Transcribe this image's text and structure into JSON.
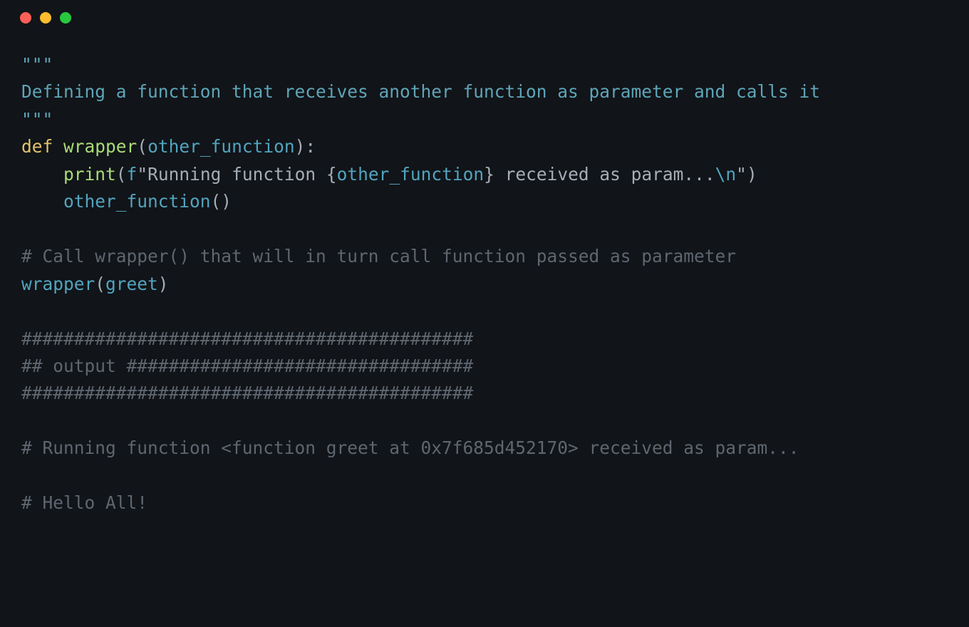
{
  "code": {
    "docstring_open": "\"\"\"",
    "docstring_text": "Defining a function that receives another function as parameter and calls it",
    "docstring_close": "\"\"\"",
    "def_kw": "def",
    "def_name": "wrapper",
    "def_paren_open": "(",
    "def_param": "other_function",
    "def_paren_close": ")",
    "def_colon": ":",
    "indent": "    ",
    "print_fn": "print",
    "print_open": "(",
    "f_prefix": "f",
    "f_open": "\"",
    "f_text1": "Running function ",
    "f_brace_open": "{",
    "f_interp": "other_function",
    "f_brace_close": "}",
    "f_text2": " received as param...",
    "f_escape": "\\n",
    "f_close": "\"",
    "print_close": ")",
    "call_fn": "other_function",
    "call_open": "(",
    "call_close": ")",
    "comment1": "# Call wrapper() that will in turn call function passed as parameter",
    "wrapper_call": "wrapper",
    "wrapper_open": "(",
    "wrapper_arg": "greet",
    "wrapper_close": ")",
    "hash_line1": "###########################################",
    "hash_line2": "## output #################################",
    "hash_line3": "###########################################",
    "out_comment1": "# Running function <function greet at 0x7f685d452170> received as param...",
    "out_comment2": "# Hello All!"
  }
}
